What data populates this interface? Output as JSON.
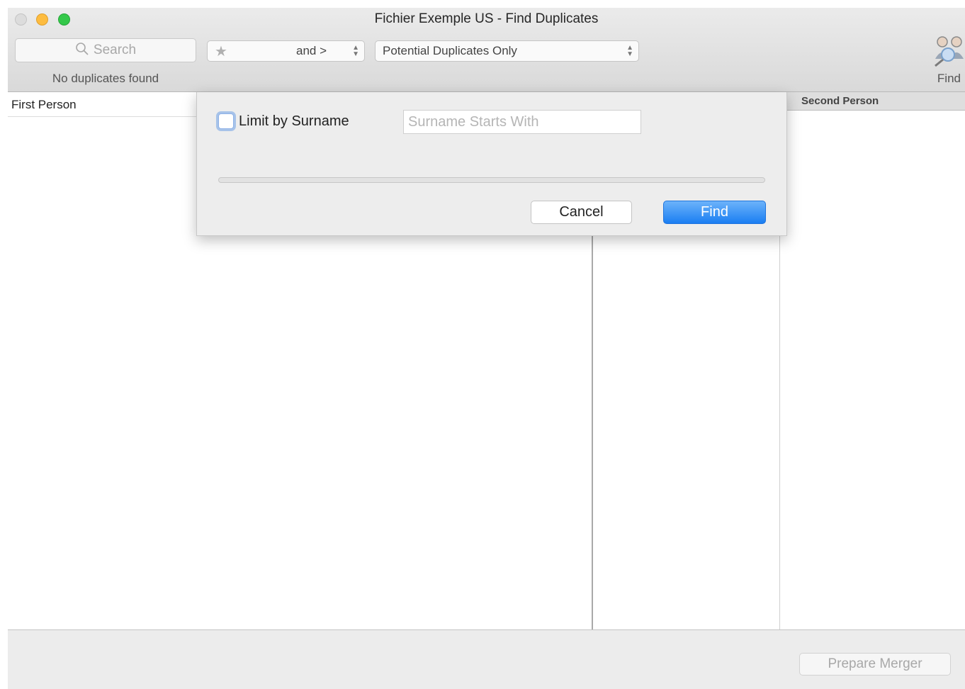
{
  "window": {
    "title": "Fichier Exemple US - Find Duplicates"
  },
  "toolbar": {
    "search_placeholder": "Search",
    "status_text": "No duplicates found",
    "rating_popup_label": "and >",
    "filter_popup_value": "Potential Duplicates Only",
    "find_tool_label": "Find"
  },
  "table": {
    "first_column_header": "First Person",
    "second_column_header": "Second Person",
    "rows": []
  },
  "sheet": {
    "checkbox_label": "Limit by Surname",
    "checkbox_checked": false,
    "surname_placeholder": "Surname Starts With",
    "surname_value": "",
    "progress_fraction": 0,
    "cancel_label": "Cancel",
    "find_label": "Find"
  },
  "footer": {
    "prepare_merger_label": "Prepare Merger"
  },
  "colors": {
    "accent": "#1a7ef2",
    "close": "#dcdcdc",
    "minimize": "#fdbc40",
    "maximize": "#34c84a"
  }
}
